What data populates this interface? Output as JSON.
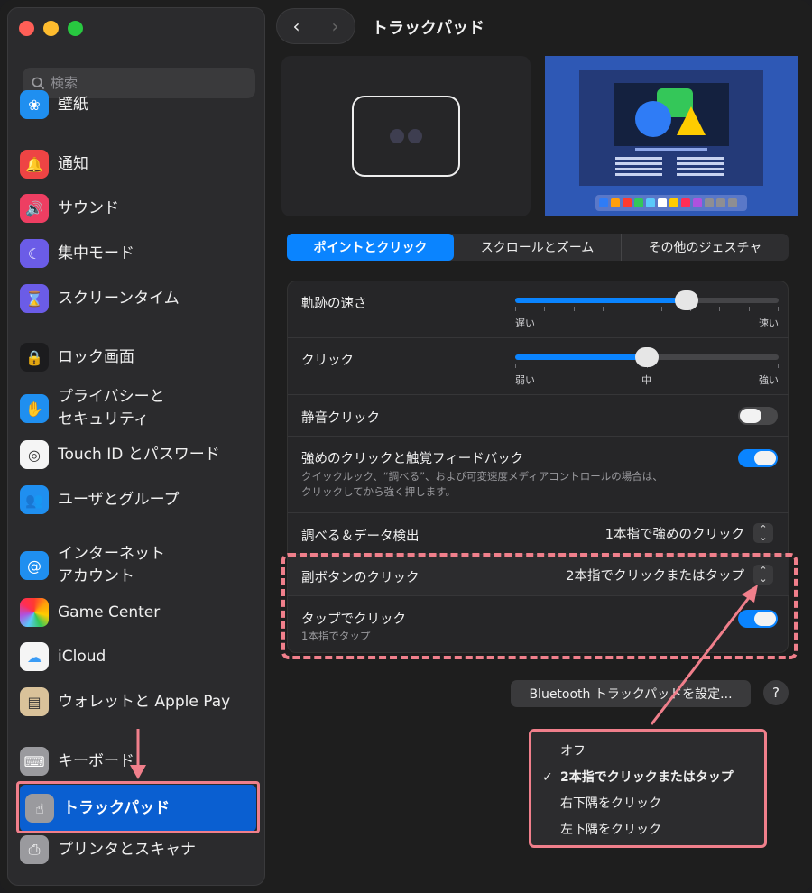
{
  "window": {
    "title": "トラックパッド"
  },
  "search": {
    "placeholder": "検索"
  },
  "sidebar": {
    "items": [
      {
        "label": "壁紙",
        "icon": "wallpaper-icon",
        "color": "#1f8ff0",
        "glyph": "❀"
      },
      {
        "label": "通知",
        "icon": "bell-icon",
        "color": "#ee4444",
        "glyph": "🔔"
      },
      {
        "label": "サウンド",
        "icon": "speaker-icon",
        "color": "#ee3e62",
        "glyph": "🔊"
      },
      {
        "label": "集中モード",
        "icon": "moon-icon",
        "color": "#6b5ce7",
        "glyph": "☾"
      },
      {
        "label": "スクリーンタイム",
        "icon": "hourglass-icon",
        "color": "#6b5ce7",
        "glyph": "⌛"
      },
      {
        "label": "ロック画面",
        "icon": "lock-icon",
        "color": "#1c1c1e",
        "glyph": "🔒"
      },
      {
        "label": "プライバシーと\nセキュリティ",
        "icon": "hand-icon",
        "color": "#1f8ff0",
        "glyph": "✋"
      },
      {
        "label": "Touch ID とパスワード",
        "icon": "fingerprint-icon",
        "color": "#f5f5f5",
        "glyph": "◎"
      },
      {
        "label": "ユーザとグループ",
        "icon": "users-icon",
        "color": "#1f8ff0",
        "glyph": "👥"
      },
      {
        "label": "インターネット\nアカウント",
        "icon": "at-icon",
        "color": "#1f8ff0",
        "glyph": "@"
      },
      {
        "label": "Game Center",
        "icon": "game-center-icon",
        "color": "#f5f5f5",
        "glyph": "●"
      },
      {
        "label": "iCloud",
        "icon": "cloud-icon",
        "color": "#f5f5f5",
        "glyph": "☁"
      },
      {
        "label": "ウォレットと Apple Pay",
        "icon": "wallet-icon",
        "color": "#d9c29a",
        "glyph": "▤"
      },
      {
        "label": "キーボード",
        "icon": "keyboard-icon",
        "color": "#9a9a9e",
        "glyph": "⌨"
      },
      {
        "label": "トラックパッド",
        "icon": "trackpad-icon",
        "color": "#9a9a9e",
        "glyph": "☝"
      },
      {
        "label": "プリンタとスキャナ",
        "icon": "printer-icon",
        "color": "#9a9a9e",
        "glyph": "⎙"
      }
    ]
  },
  "tabs": [
    {
      "label": "ポイントとクリック",
      "active": true
    },
    {
      "label": "スクロールとズーム",
      "active": false
    },
    {
      "label": "その他のジェスチャ",
      "active": false
    }
  ],
  "settings": {
    "tracking_speed": {
      "label": "軌跡の速さ",
      "min_label": "遅い",
      "max_label": "速い",
      "value": 0.65
    },
    "click": {
      "label": "クリック",
      "min_label": "弱い",
      "mid_label": "中",
      "max_label": "強い",
      "value": 0.5
    },
    "silent_click": {
      "label": "静音クリック",
      "on": false
    },
    "force_click": {
      "label": "強めのクリックと触覚フィードバック",
      "description": "クイックルック、“調べる”、および可変速度メディアコントロールの場合は、\nクリックしてから強く押します。",
      "on": true
    },
    "lookup": {
      "label": "調べる＆データ検出",
      "value": "1本指で強めのクリック"
    },
    "secondary_click": {
      "label": "副ボタンのクリック",
      "value": "2本指でクリックまたはタップ"
    },
    "tap_to_click": {
      "label": "タップでクリック",
      "description": "1本指でタップ",
      "on": true
    }
  },
  "buttons": {
    "bluetooth": "Bluetooth トラックパッドを設定...",
    "help": "?"
  },
  "menu": {
    "items": [
      {
        "label": "オフ",
        "checked": false
      },
      {
        "label": "2本指でクリックまたはタップ",
        "checked": true
      },
      {
        "label": "右下隅をクリック",
        "checked": false
      },
      {
        "label": "左下隅をクリック",
        "checked": false
      }
    ],
    "check_glyph": "✓"
  },
  "colors": {
    "accent": "#0a84ff",
    "annotation": "#f07f8b",
    "selection": "#0a5fd1"
  }
}
